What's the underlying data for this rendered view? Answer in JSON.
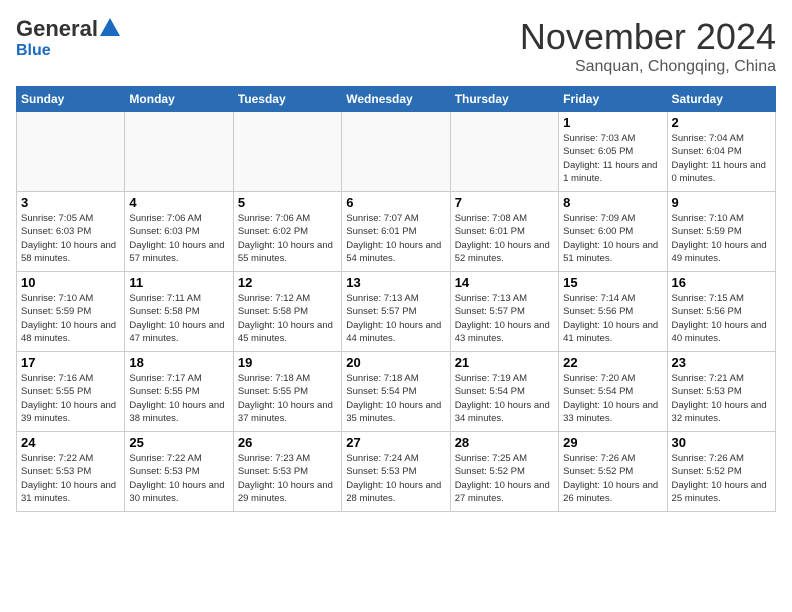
{
  "header": {
    "logo_general": "General",
    "logo_blue": "Blue",
    "month_title": "November 2024",
    "location": "Sanquan, Chongqing, China"
  },
  "weekdays": [
    "Sunday",
    "Monday",
    "Tuesday",
    "Wednesday",
    "Thursday",
    "Friday",
    "Saturday"
  ],
  "weeks": [
    [
      {
        "day": "",
        "info": ""
      },
      {
        "day": "",
        "info": ""
      },
      {
        "day": "",
        "info": ""
      },
      {
        "day": "",
        "info": ""
      },
      {
        "day": "",
        "info": ""
      },
      {
        "day": "1",
        "info": "Sunrise: 7:03 AM\nSunset: 6:05 PM\nDaylight: 11 hours and 1 minute."
      },
      {
        "day": "2",
        "info": "Sunrise: 7:04 AM\nSunset: 6:04 PM\nDaylight: 11 hours and 0 minutes."
      }
    ],
    [
      {
        "day": "3",
        "info": "Sunrise: 7:05 AM\nSunset: 6:03 PM\nDaylight: 10 hours and 58 minutes."
      },
      {
        "day": "4",
        "info": "Sunrise: 7:06 AM\nSunset: 6:03 PM\nDaylight: 10 hours and 57 minutes."
      },
      {
        "day": "5",
        "info": "Sunrise: 7:06 AM\nSunset: 6:02 PM\nDaylight: 10 hours and 55 minutes."
      },
      {
        "day": "6",
        "info": "Sunrise: 7:07 AM\nSunset: 6:01 PM\nDaylight: 10 hours and 54 minutes."
      },
      {
        "day": "7",
        "info": "Sunrise: 7:08 AM\nSunset: 6:01 PM\nDaylight: 10 hours and 52 minutes."
      },
      {
        "day": "8",
        "info": "Sunrise: 7:09 AM\nSunset: 6:00 PM\nDaylight: 10 hours and 51 minutes."
      },
      {
        "day": "9",
        "info": "Sunrise: 7:10 AM\nSunset: 5:59 PM\nDaylight: 10 hours and 49 minutes."
      }
    ],
    [
      {
        "day": "10",
        "info": "Sunrise: 7:10 AM\nSunset: 5:59 PM\nDaylight: 10 hours and 48 minutes."
      },
      {
        "day": "11",
        "info": "Sunrise: 7:11 AM\nSunset: 5:58 PM\nDaylight: 10 hours and 47 minutes."
      },
      {
        "day": "12",
        "info": "Sunrise: 7:12 AM\nSunset: 5:58 PM\nDaylight: 10 hours and 45 minutes."
      },
      {
        "day": "13",
        "info": "Sunrise: 7:13 AM\nSunset: 5:57 PM\nDaylight: 10 hours and 44 minutes."
      },
      {
        "day": "14",
        "info": "Sunrise: 7:13 AM\nSunset: 5:57 PM\nDaylight: 10 hours and 43 minutes."
      },
      {
        "day": "15",
        "info": "Sunrise: 7:14 AM\nSunset: 5:56 PM\nDaylight: 10 hours and 41 minutes."
      },
      {
        "day": "16",
        "info": "Sunrise: 7:15 AM\nSunset: 5:56 PM\nDaylight: 10 hours and 40 minutes."
      }
    ],
    [
      {
        "day": "17",
        "info": "Sunrise: 7:16 AM\nSunset: 5:55 PM\nDaylight: 10 hours and 39 minutes."
      },
      {
        "day": "18",
        "info": "Sunrise: 7:17 AM\nSunset: 5:55 PM\nDaylight: 10 hours and 38 minutes."
      },
      {
        "day": "19",
        "info": "Sunrise: 7:18 AM\nSunset: 5:55 PM\nDaylight: 10 hours and 37 minutes."
      },
      {
        "day": "20",
        "info": "Sunrise: 7:18 AM\nSunset: 5:54 PM\nDaylight: 10 hours and 35 minutes."
      },
      {
        "day": "21",
        "info": "Sunrise: 7:19 AM\nSunset: 5:54 PM\nDaylight: 10 hours and 34 minutes."
      },
      {
        "day": "22",
        "info": "Sunrise: 7:20 AM\nSunset: 5:54 PM\nDaylight: 10 hours and 33 minutes."
      },
      {
        "day": "23",
        "info": "Sunrise: 7:21 AM\nSunset: 5:53 PM\nDaylight: 10 hours and 32 minutes."
      }
    ],
    [
      {
        "day": "24",
        "info": "Sunrise: 7:22 AM\nSunset: 5:53 PM\nDaylight: 10 hours and 31 minutes."
      },
      {
        "day": "25",
        "info": "Sunrise: 7:22 AM\nSunset: 5:53 PM\nDaylight: 10 hours and 30 minutes."
      },
      {
        "day": "26",
        "info": "Sunrise: 7:23 AM\nSunset: 5:53 PM\nDaylight: 10 hours and 29 minutes."
      },
      {
        "day": "27",
        "info": "Sunrise: 7:24 AM\nSunset: 5:53 PM\nDaylight: 10 hours and 28 minutes."
      },
      {
        "day": "28",
        "info": "Sunrise: 7:25 AM\nSunset: 5:52 PM\nDaylight: 10 hours and 27 minutes."
      },
      {
        "day": "29",
        "info": "Sunrise: 7:26 AM\nSunset: 5:52 PM\nDaylight: 10 hours and 26 minutes."
      },
      {
        "day": "30",
        "info": "Sunrise: 7:26 AM\nSunset: 5:52 PM\nDaylight: 10 hours and 25 minutes."
      }
    ]
  ]
}
